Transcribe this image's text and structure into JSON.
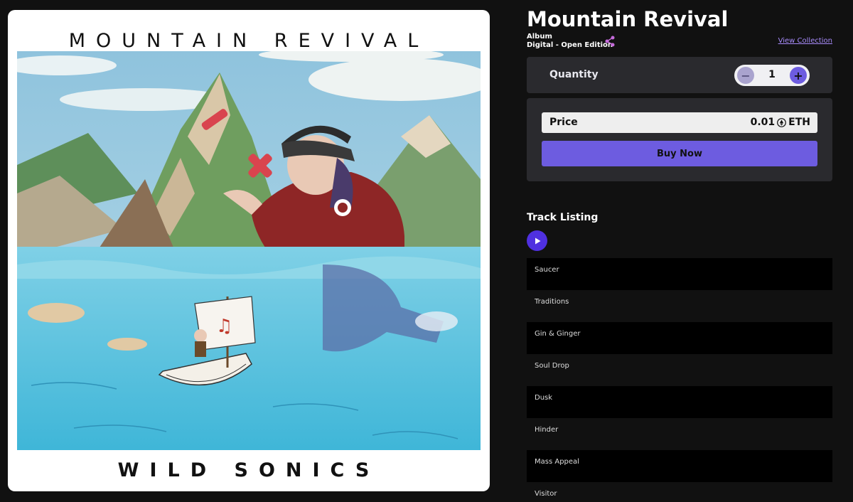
{
  "cover": {
    "title": "MOUNTAIN REVIVAL",
    "artist": "WILD SONICS"
  },
  "product": {
    "title": "Mountain Revival",
    "type": "Album",
    "edition": "Digital - Open Edition",
    "view_collection": "View Collection"
  },
  "quantity": {
    "label": "Quantity",
    "value": "1",
    "minus": "−",
    "plus": "+"
  },
  "price": {
    "label": "Price",
    "amount": "0.01",
    "currency": "ETH",
    "buy_label": "Buy Now"
  },
  "tracks": {
    "heading": "Track Listing",
    "items": [
      {
        "title": "Saucer"
      },
      {
        "title": "Traditions"
      },
      {
        "title": "Gin & Ginger"
      },
      {
        "title": "Soul Drop"
      },
      {
        "title": "Dusk"
      },
      {
        "title": "Hinder"
      },
      {
        "title": "Mass Appeal"
      },
      {
        "title": "Visitor"
      }
    ]
  },
  "icons": [
    "share-icon",
    "eth-icon",
    "play-icon",
    "minus-icon",
    "plus-icon"
  ],
  "colors": {
    "accent": "#6d5ce0",
    "play": "#4f30e0",
    "link": "#a78bfa",
    "background": "#111111",
    "panel": "#2a2a2e"
  }
}
